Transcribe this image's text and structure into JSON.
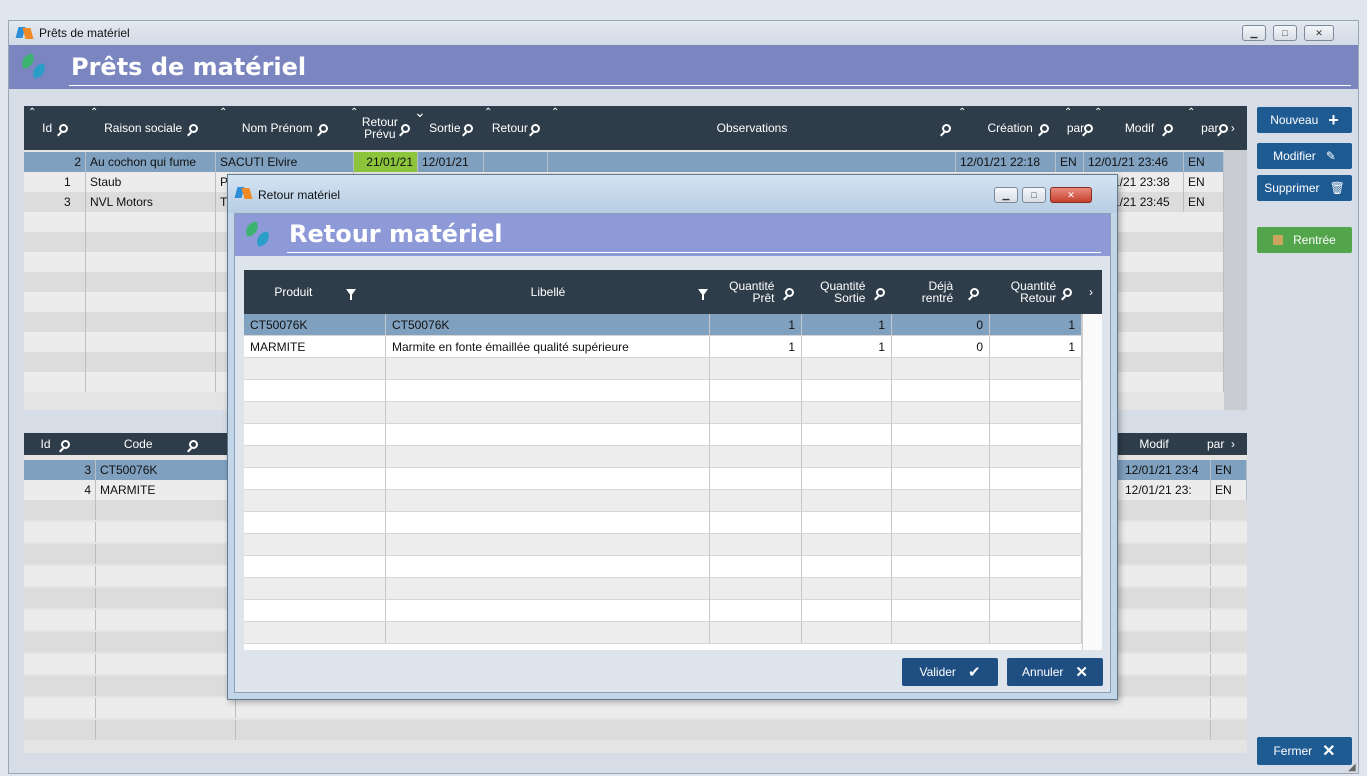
{
  "window": {
    "title": "Prêts de matériel",
    "header": "Prêts de matériel",
    "controls": [
      "–",
      "□",
      "✕"
    ]
  },
  "loans_grid": {
    "headers": [
      "Id",
      "Raison sociale",
      "Nom Prénom",
      "Retour Prévu",
      "Sortie",
      "Retour",
      "Observations",
      "Création",
      "par",
      "Modif",
      "par"
    ],
    "rows": [
      {
        "id": "2",
        "raison": "Au cochon qui fume",
        "nom": "SACUTI Elvire",
        "retour_prevu": "21/01/21",
        "sortie": "12/01/21",
        "retour": "",
        "observations": "",
        "creation": "12/01/21 22:18",
        "par1": "EN",
        "modif": "12/01/21 23:46",
        "par2": "EN"
      },
      {
        "id": "1",
        "raison": "Staub",
        "nom": "P",
        "retour_prevu": "",
        "sortie": "",
        "retour": "",
        "observations": "",
        "creation": "",
        "par1": "",
        "modif": "1/21 23:38",
        "par2": "EN"
      },
      {
        "id": "3",
        "raison": "NVL Motors",
        "nom": "T",
        "retour_prevu": "",
        "sortie": "",
        "retour": "",
        "observations": "",
        "creation": "",
        "par1": "",
        "modif": "1/21 23:45",
        "par2": "EN"
      }
    ]
  },
  "items_grid": {
    "headers": [
      "Id",
      "Code",
      "Modif",
      "par"
    ],
    "rows": [
      {
        "id": "3",
        "code": "CT50076K",
        "modif": "12/01/21 23:4",
        "par": "EN"
      },
      {
        "id": "4",
        "code": "MARMITE",
        "modif": "12/01/21 23:",
        "par": "EN"
      }
    ]
  },
  "side_buttons": {
    "nouveau": "Nouveau",
    "modifier": "Modifier",
    "supprimer": "Supprimer",
    "rentree": "Rentrée",
    "fermer": "Fermer"
  },
  "dialog": {
    "title": "Retour matériel",
    "header": "Retour matériel",
    "columns": {
      "produit": "Produit",
      "libelle": "Libellé",
      "qte_pret": "Quantité Prêt",
      "qte_sortie": "Quantité Sortie",
      "deja_rentre": "Déjà rentré",
      "qte_retour": "Quantité Retour"
    },
    "rows": [
      {
        "produit": "CT50076K",
        "libelle": "CT50076K",
        "qte_pret": "1",
        "qte_sortie": "1",
        "deja_rentre": "0",
        "qte_retour": "1"
      },
      {
        "produit": "MARMITE",
        "libelle": "Marmite en fonte émaillée qualité supérieure",
        "qte_pret": "1",
        "qte_sortie": "1",
        "deja_rentre": "0",
        "qte_retour": "1"
      }
    ],
    "valider": "Valider",
    "annuler": "Annuler"
  },
  "colors": {
    "header_band": "#7b86c1",
    "dialog_band": "#8e99d8",
    "grid_header": "#2f3d4b",
    "selected_row": "#7fa0bf",
    "button": "#1f5b93",
    "green": "#52a54b",
    "date_highlight": "#8cc43c"
  }
}
